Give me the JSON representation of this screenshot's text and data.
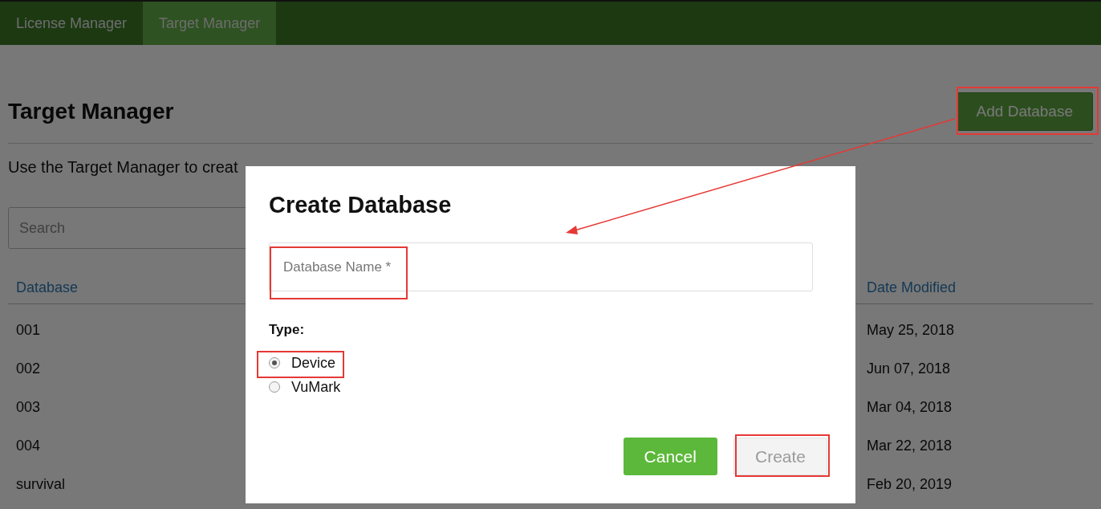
{
  "nav": {
    "tabs": [
      {
        "label": "License Manager",
        "selected": false
      },
      {
        "label": "Target Manager",
        "selected": true
      }
    ]
  },
  "page": {
    "title": "Target Manager",
    "add_button": "Add Database",
    "description": "Use the Target Manager to creat",
    "search": {
      "placeholder": "Search"
    },
    "table": {
      "columns": [
        "Database",
        "Date Modified"
      ],
      "rows": [
        {
          "database": "001",
          "date_modified": "May 25, 2018"
        },
        {
          "database": "002",
          "date_modified": "Jun 07, 2018"
        },
        {
          "database": "003",
          "date_modified": "Mar 04, 2018"
        },
        {
          "database": "004",
          "date_modified": "Mar 22, 2018"
        },
        {
          "database": "survival",
          "date_modified": "Feb 20, 2019"
        }
      ]
    }
  },
  "dialog": {
    "title": "Create Database",
    "name_field": {
      "placeholder": "Database Name *"
    },
    "type_label": "Type:",
    "options": [
      {
        "label": "Device",
        "selected": true
      },
      {
        "label": "VuMark",
        "selected": false
      }
    ],
    "buttons": [
      {
        "label": "Cancel",
        "kind": "primary",
        "disabled": false
      },
      {
        "label": "Create",
        "kind": "secondary",
        "disabled": true
      }
    ]
  }
}
